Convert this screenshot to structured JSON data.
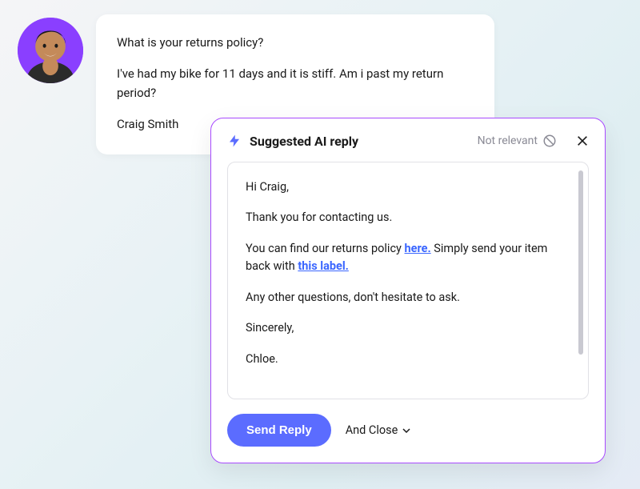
{
  "message": {
    "line1": "What is your returns policy?",
    "line2": "I've had my bike for 11 days and it is stiff. Am i past my return period?",
    "signature": "Craig Smith"
  },
  "ai": {
    "title": "Suggested AI reply",
    "not_relevant_label": "Not relevant",
    "reply": {
      "greeting": "Hi Craig,",
      "line1": "Thank you for contacting us.",
      "line2_pre": "You can find our returns policy ",
      "link1": "here.",
      "line2_mid": " Simply send your item back with ",
      "link2": "this label.",
      "line3": "Any other questions, don't hesitate to ask.",
      "signoff": "Sincerely,",
      "name": "Chloe."
    },
    "send_label": "Send Reply",
    "and_close_label": "And Close"
  }
}
